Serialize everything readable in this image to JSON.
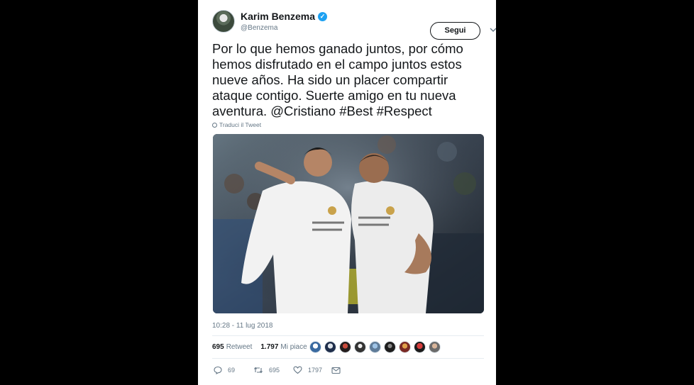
{
  "tweet": {
    "author": {
      "name": "Karim Benzema",
      "handle": "@Benzema",
      "verified_glyph": "✓"
    },
    "follow_label": "Segui",
    "caret_glyph": "⌄",
    "text": "Por lo que hemos ganado juntos, por cómo hemos disfrutado en el campo juntos estos nueve años. Ha sido un placer compartir ataque contigo. Suerte amigo en tu nueva aventura. @Cristiano #Best #Respect",
    "translate_label": "Traduci il Tweet",
    "timestamp": "10:28 - 11 lug 2018",
    "stats": {
      "retweets_count": "695",
      "retweets_label": "Retweet",
      "likes_count": "1.797",
      "likes_label": "Mi piace"
    },
    "actions": {
      "reply_count": "69",
      "retweet_count": "695",
      "like_count": "1797"
    }
  },
  "icons": [
    "verified-badge-icon",
    "chevron-down-icon",
    "globe-icon",
    "reply-icon",
    "retweet-icon",
    "heart-icon",
    "envelope-icon"
  ],
  "colors": {
    "background": "#000000",
    "card": "#ffffff",
    "text": "#14171a",
    "secondary": "#657786",
    "verified": "#1da1f2",
    "divider": "#e6ecf0"
  }
}
